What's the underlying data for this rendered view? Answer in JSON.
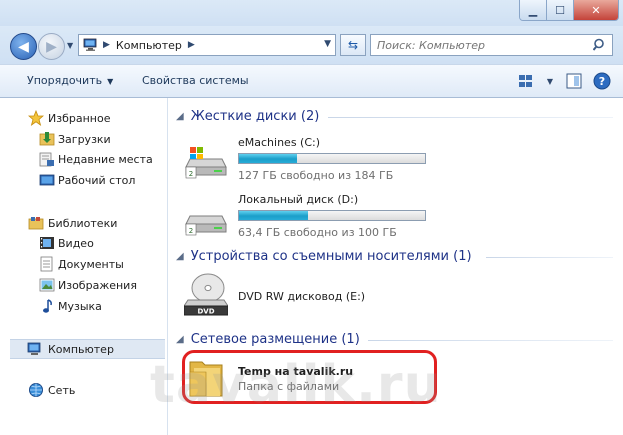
{
  "address": {
    "location": "Компьютер"
  },
  "search": {
    "placeholder": "Поиск: Компьютер"
  },
  "toolbar": {
    "organize_label": "Упорядочить",
    "system_props_label": "Свойства системы"
  },
  "nav": {
    "favorites": "Избранное",
    "downloads": "Загрузки",
    "recent": "Недавние места",
    "desktop": "Рабочий стол",
    "libraries": "Библиотеки",
    "video": "Видео",
    "documents": "Документы",
    "images": "Изображения",
    "music": "Музыка",
    "computer": "Компьютер",
    "network": "Сеть"
  },
  "groups": {
    "hard_disks": "Жесткие диски (2)",
    "removable": "Устройства со съемными носителями (1)",
    "network": "Сетевое размещение (1)"
  },
  "drives": [
    {
      "name": "eMachines (C:)",
      "free": "127 ГБ свободно из 184 ГБ",
      "used_fraction": 0.31
    },
    {
      "name": "Локальный диск (D:)",
      "free": "63,4 ГБ свободно из 100 ГБ",
      "used_fraction": 0.37
    }
  ],
  "removable": {
    "name": "DVD RW дисковод (E:)"
  },
  "network_item": {
    "name": "Temp на tavalik.ru",
    "type": "Папка с файлами"
  },
  "watermark": "tavalik.ru",
  "colors": {
    "accent": "#1e3287",
    "highlight": "#e12020",
    "bar_fill": "#26acd8"
  }
}
